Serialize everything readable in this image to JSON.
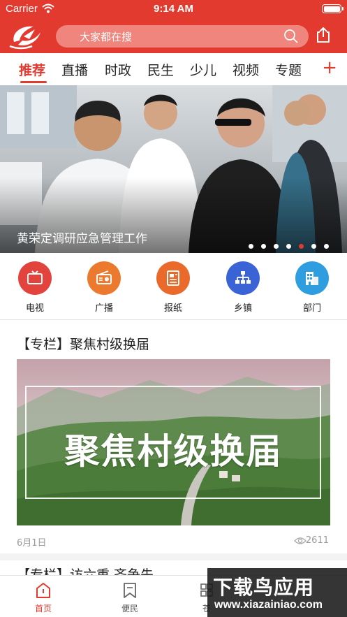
{
  "status_bar": {
    "carrier": "Carrier",
    "time": "9:14 AM",
    "battery_level": 1.0
  },
  "header": {
    "search_placeholder": "大家都在搜",
    "logo_icon": "app-logo",
    "share_icon": "share-icon"
  },
  "tabs": [
    {
      "label": "推荐",
      "active": true
    },
    {
      "label": "直播"
    },
    {
      "label": "时政"
    },
    {
      "label": "民生"
    },
    {
      "label": "少儿"
    },
    {
      "label": "视频"
    },
    {
      "label": "专题"
    }
  ],
  "tabs_more": "+",
  "banner": {
    "caption": "黄荣定调研应急管理工作",
    "page_count": 7,
    "active_page": 5
  },
  "quick_links": [
    {
      "label": "电视",
      "icon": "tv-icon",
      "color": "#e2443d"
    },
    {
      "label": "广播",
      "icon": "radio-icon",
      "color": "#ec7a2e"
    },
    {
      "label": "报纸",
      "icon": "newspaper-icon",
      "color": "#ea6a2c"
    },
    {
      "label": "乡镇",
      "icon": "org-chart-icon",
      "color": "#3a63d6"
    },
    {
      "label": "部门",
      "icon": "building-icon",
      "color": "#2e9ee0"
    }
  ],
  "article": {
    "title": "【专栏】聚焦村级换届",
    "image_text": "聚焦村级换届",
    "date": "6月1日",
    "views": "2611"
  },
  "article2": {
    "title": "【专栏】访六重 齐争先"
  },
  "bottom_nav": [
    {
      "label": "首页",
      "icon": "home-icon",
      "active": true
    },
    {
      "label": "便民",
      "icon": "bookmark-icon"
    },
    {
      "label": "苍",
      "icon": "grid-icon"
    }
  ],
  "watermark": {
    "title": "下载鸟应用",
    "url": "www.xiazainiao.com"
  },
  "colors": {
    "brand": "#e23a2e"
  }
}
